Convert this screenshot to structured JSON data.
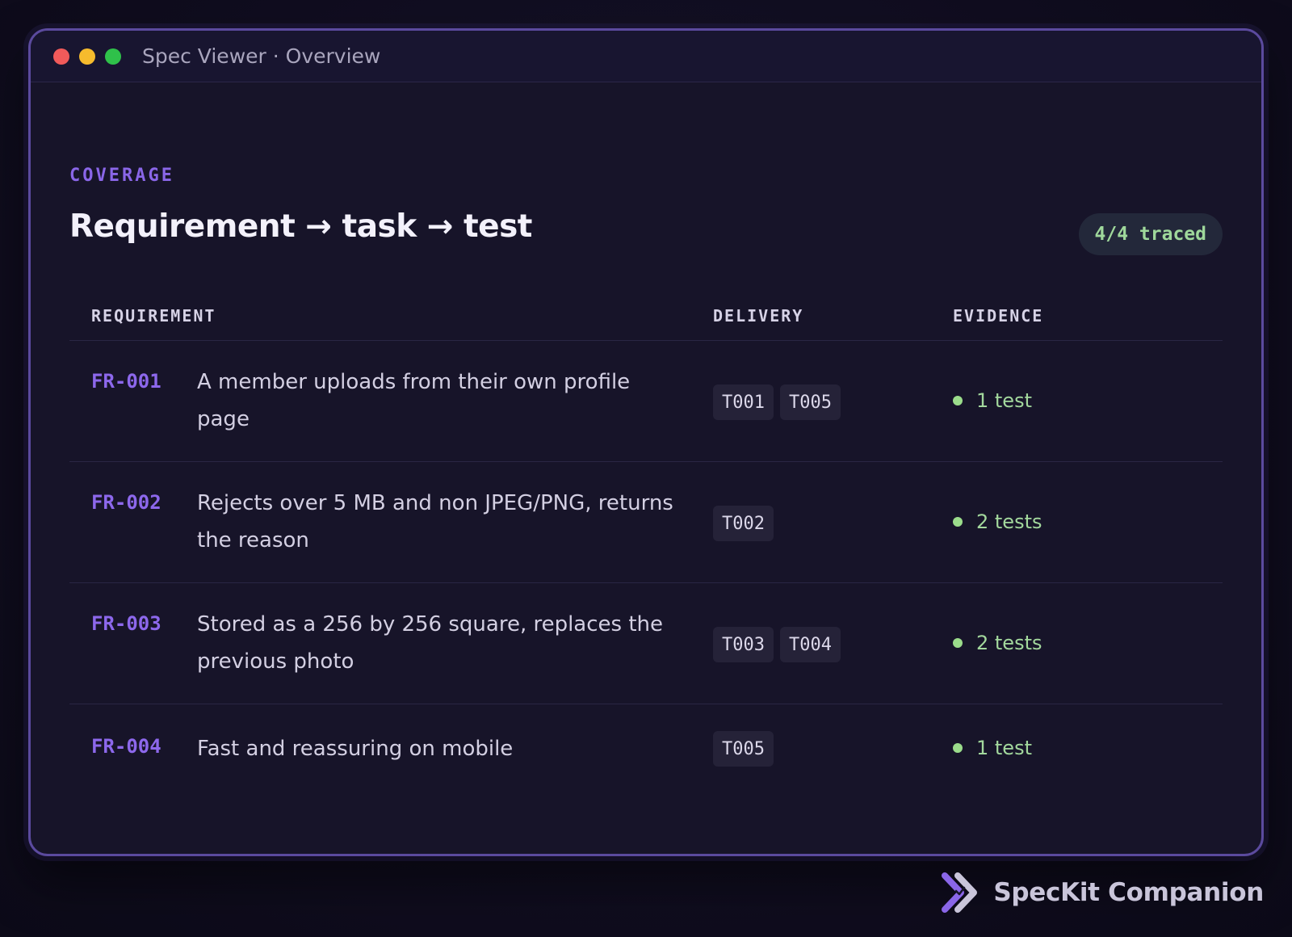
{
  "window": {
    "title": "Spec Viewer · Overview"
  },
  "section": {
    "eyebrow": "COVERAGE",
    "title": "Requirement → task → test",
    "badge": "4/4 traced"
  },
  "table": {
    "headers": {
      "requirement": "REQUIREMENT",
      "delivery": "DELIVERY",
      "evidence": "EVIDENCE"
    },
    "rows": [
      {
        "id": "FR-001",
        "text": "A member uploads from their own profile page",
        "tasks": [
          "T001",
          "T005"
        ],
        "evidence": "1 test"
      },
      {
        "id": "FR-002",
        "text": "Rejects over 5 MB and non JPEG/PNG, returns the reason",
        "tasks": [
          "T002"
        ],
        "evidence": "2 tests"
      },
      {
        "id": "FR-003",
        "text": "Stored as a 256 by 256 square, replaces the previous photo",
        "tasks": [
          "T003",
          "T004"
        ],
        "evidence": "2 tests"
      },
      {
        "id": "FR-004",
        "text": "Fast and reassuring on mobile",
        "tasks": [
          "T005"
        ],
        "evidence": "1 test"
      }
    ]
  },
  "brand": {
    "name": "SpecKit Companion",
    "icon": "speckit-logo-icon"
  },
  "colors": {
    "accent": "#8d68ec",
    "success": "#a3d89d",
    "window_border": "#5b4a9e"
  }
}
